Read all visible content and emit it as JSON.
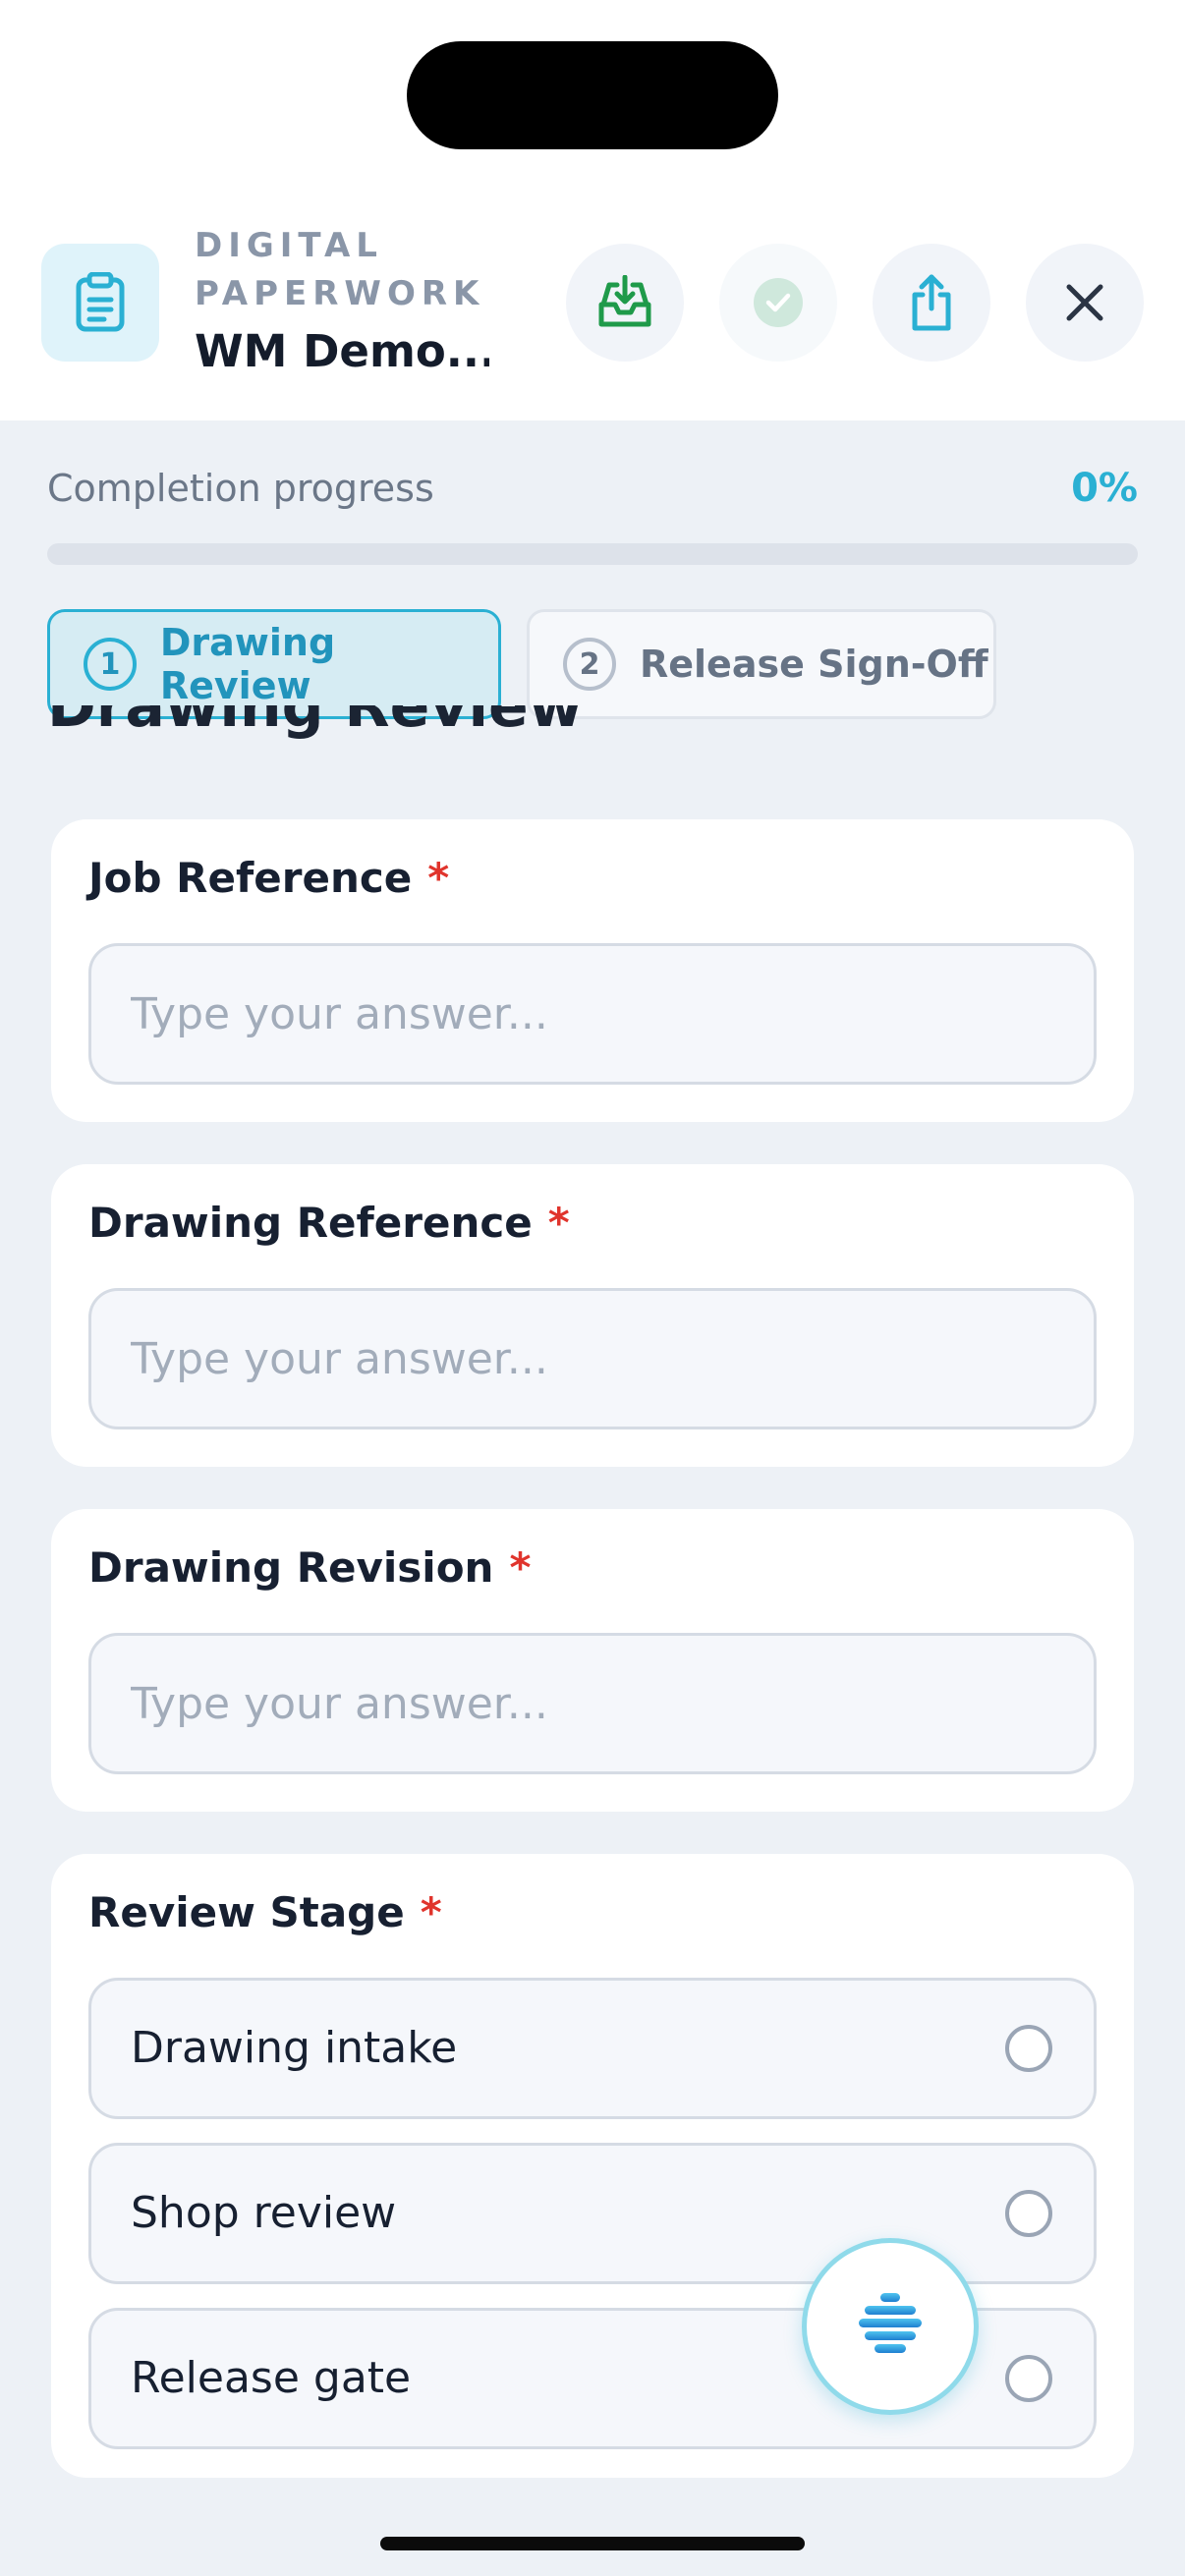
{
  "header": {
    "eyebrow": "DIGITAL PAPERWORK",
    "title": "WM Demo...",
    "icons": {
      "document": "clipboard-icon",
      "save": "inbox-download-icon",
      "complete": "check-circle-icon",
      "share": "share-icon",
      "close": "close-icon"
    }
  },
  "progress": {
    "label": "Completion progress",
    "value_text": "0%",
    "value": 0,
    "color": "#2ab0d3"
  },
  "tabs": [
    {
      "number": "1",
      "label": "Drawing Review",
      "active": true
    },
    {
      "number": "2",
      "label": "Release Sign-Off",
      "active": false
    }
  ],
  "section": {
    "title": "Drawing Review"
  },
  "fields": [
    {
      "label": "Job Reference",
      "required_mark": "*",
      "placeholder": "Type your answer..."
    },
    {
      "label": "Drawing Reference",
      "required_mark": "*",
      "placeholder": "Type your answer..."
    },
    {
      "label": "Drawing Revision",
      "required_mark": "*",
      "placeholder": "Type your answer..."
    }
  ],
  "review_stage": {
    "label": "Review Stage",
    "required_mark": "*",
    "options": [
      "Drawing intake",
      "Shop review",
      "Release gate"
    ]
  },
  "fab": {
    "icon": "stack-lines-icon"
  }
}
